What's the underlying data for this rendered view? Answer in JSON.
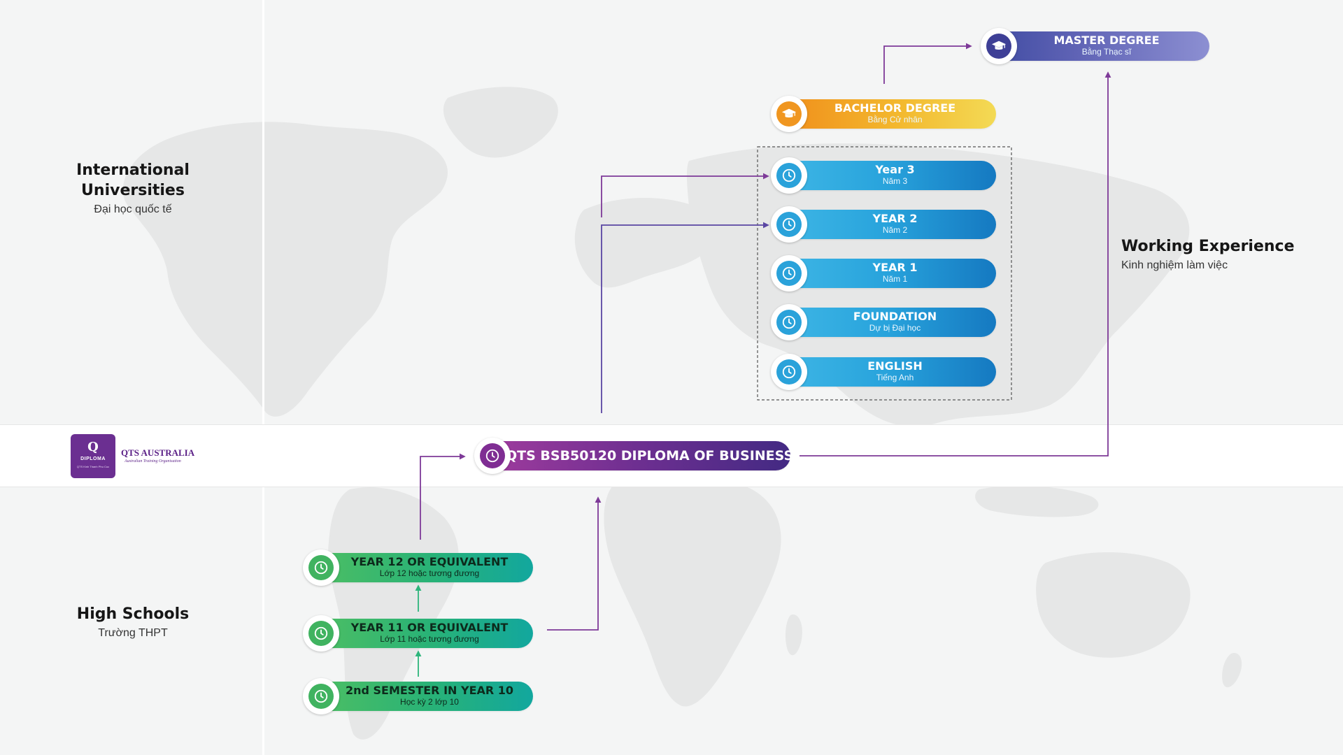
{
  "colors": {
    "background": "#f4f5f5",
    "map": "#e6e7e7",
    "band": "#ffffff",
    "purple_line": "#7e3a98",
    "indigo_line": "#5a46a3",
    "green_line": "#2db57b",
    "dashed_box": "#555555"
  },
  "sections": {
    "international": {
      "title": "International Universities",
      "subtitle": "Đại học quốc tế"
    },
    "working": {
      "title": "Working Experience",
      "subtitle": "Kinh nghiệm làm việc"
    },
    "high_schools": {
      "title": "High Schools",
      "subtitle": "Trường THPT"
    }
  },
  "brand": {
    "logo_glyph": "Q",
    "logo_word": "DIPLOMA",
    "logo_sub": "QTS Kinh Thanh Phu Cuc",
    "name": "QTS AUSTRALIA",
    "tagline": "Australian Training Organisation"
  },
  "nodes": {
    "master": {
      "label": "MASTER DEGREE",
      "sub": "Bằng Thạc sĩ",
      "icon": "graduation-cap-icon"
    },
    "bachelor": {
      "label": "BACHELOR DEGREE",
      "sub": "Bằng Cử nhân",
      "icon": "graduation-cap-icon"
    },
    "year3": {
      "label": "Year 3",
      "sub": "Năm 3",
      "icon": "clock-icon"
    },
    "year2": {
      "label": "YEAR 2",
      "sub": "Năm 2",
      "icon": "clock-icon"
    },
    "year1": {
      "label": "YEAR 1",
      "sub": "Năm 1",
      "icon": "clock-icon"
    },
    "foundation": {
      "label": "FOUNDATION",
      "sub": "Dự bị Đại học",
      "icon": "clock-icon"
    },
    "english": {
      "label": "ENGLISH",
      "sub": "Tiếng Anh",
      "icon": "clock-icon"
    },
    "diploma": {
      "label": "QTS BSB50120 DIPLOMA OF BUSINESS",
      "icon": "clock-icon"
    },
    "year12": {
      "label": "YEAR 12 OR EQUIVALENT",
      "sub": "Lớp 12 hoặc tương đương",
      "icon": "clock-icon"
    },
    "year11": {
      "label": "YEAR 11 OR EQUIVALENT",
      "sub": "Lớp 11 hoặc tương đương",
      "icon": "clock-icon"
    },
    "year10": {
      "label": "2nd SEMESTER IN YEAR 10",
      "sub": "Học kỳ 2 lớp 10",
      "icon": "clock-icon"
    }
  }
}
